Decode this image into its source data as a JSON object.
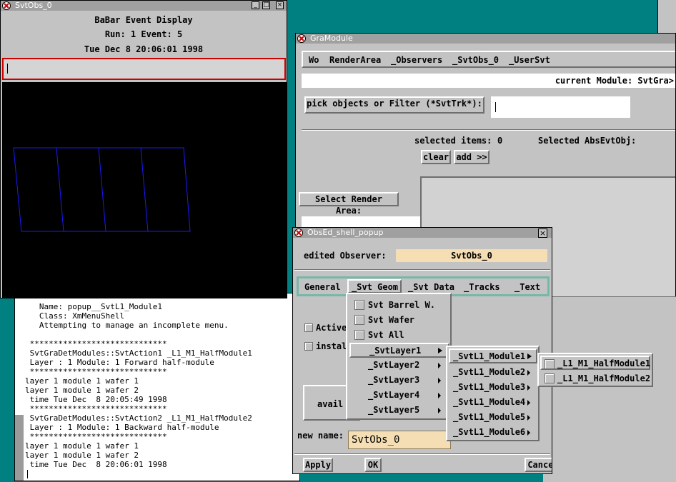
{
  "svtobs": {
    "title": "SvtObs_0",
    "header_line1": "BaBar Event Display",
    "header_line2": "Run: 1  Event: 5",
    "header_line3": "Tue Dec  8 20:06:01 1998"
  },
  "console": {
    "lines": [
      "   Name: popup__SvtL1_Module1",
      "   Class: XmMenuShell",
      "   Attempting to manage an incomplete menu.",
      "",
      " *****************************",
      " SvtGraDetModules::SvtAction1 _L1_M1_HalfModule1",
      " Layer : 1 Module: 1 Forward half-module",
      " *****************************",
      "layer 1 module 1 wafer 1",
      "layer 1 module 1 wafer 2",
      " time Tue Dec  8 20:05:49 1998",
      " *****************************",
      " SvtGraDetModules::SvtAction2 _L1_M1_HalfModule2",
      " Layer : 1 Module: 1 Backward half-module",
      " *****************************",
      "layer 1 module 1 wafer 1",
      "layer 1 module 1 wafer 2",
      " time Tue Dec  8 20:06:01 1998"
    ]
  },
  "gramodule": {
    "title": "GraModule",
    "menu": [
      "Wo",
      "RenderArea",
      "_Observers",
      "_SvtObs_0",
      "_UserSvt"
    ],
    "current_module": "current Module: SvtGra>",
    "pick_label": "pick objects or Filter (*SvtTrk*):",
    "selected_items_label": "selected items:",
    "selected_items_value": "0",
    "selected_absevtobj_label": "Selected AbsEvtObj:",
    "clear_label": "clear",
    "add_label": "add >>",
    "select_render_area": "Select Render Area:"
  },
  "obsed": {
    "title": "ObsEd_shell_popup",
    "edited_observer_label": "edited Observer:",
    "edited_observer_value": "SvtObs_0",
    "tabs": [
      "General",
      "_Svt Geom",
      "_Svt Data",
      "_Tracks",
      "_Text"
    ],
    "active_label": "Active",
    "install_label": "instal",
    "avail_label": "avail",
    "new_name_label": "new name:",
    "new_name_value": "SvtObs_0",
    "apply_label": "Apply",
    "ok_label": "OK",
    "cancel_label": "Cancel"
  },
  "geom_menu": {
    "checks": [
      "Svt Barrel W.",
      "Svt Wafer",
      "Svt All"
    ],
    "layers": [
      "_SvtLayer1",
      "_SvtLayer2",
      "_SvtLayer3",
      "_SvtLayer4",
      "_SvtLayer5"
    ]
  },
  "module_menu": {
    "items": [
      "_SvtL1_Module1",
      "_SvtL1_Module2",
      "_SvtL1_Module3",
      "_SvtL1_Module4",
      "_SvtL1_Module5",
      "_SvtL1_Module6"
    ]
  },
  "halfmodule_menu": {
    "items": [
      "_L1_M1_HalfModule1",
      "_L1_M1_HalfModule2"
    ]
  },
  "colors": {
    "desktop": "#008080",
    "window_bg": "#c3c3c3",
    "display_bg": "#000000",
    "wire": "#1a1aff",
    "input_highlight": "#cc0000",
    "observer_field": "#f5deb3"
  }
}
